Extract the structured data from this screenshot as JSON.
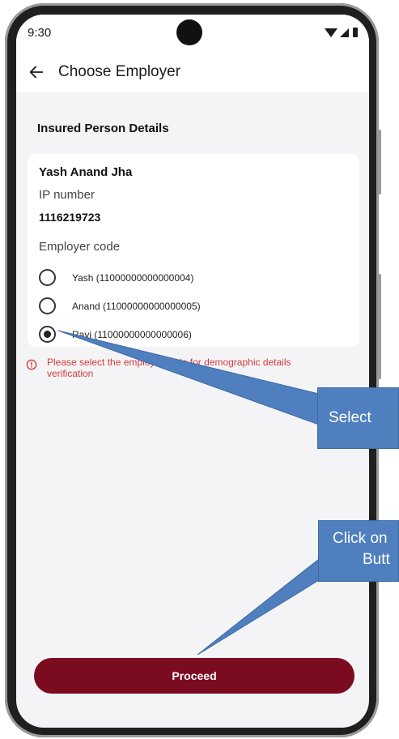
{
  "status_bar": {
    "time": "9:30"
  },
  "app_bar": {
    "title": "Choose Employer",
    "back_icon": "arrow-left-icon"
  },
  "section": {
    "title": "Insured Person Details"
  },
  "card": {
    "name": "Yash Anand Jha",
    "ip_label": "IP number",
    "ip_value": "1116219723",
    "employer_label": "Employer code",
    "options": [
      {
        "label": "Yash (11000000000000004)",
        "selected": false
      },
      {
        "label": "Anand (11000000000000005)",
        "selected": false
      },
      {
        "label": "Ravi (11000000000000006)",
        "selected": true
      }
    ]
  },
  "error": {
    "text": "Please select the employer code for demographic details verification",
    "color": "#d63b3b",
    "icon": "info-circle-icon"
  },
  "proceed_button": {
    "label": "Proceed",
    "color": "#7b0b1f"
  },
  "callouts": {
    "select": {
      "text": "Select"
    },
    "click": {
      "line1": "Click on",
      "line2": "Butt"
    },
    "color": "#4f7fbf"
  }
}
